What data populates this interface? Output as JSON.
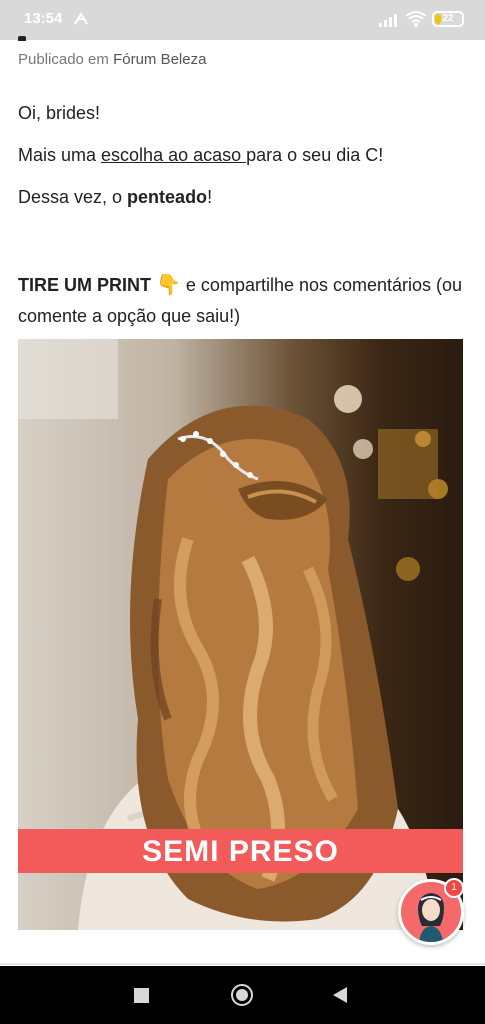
{
  "status_bar": {
    "time": "13:54",
    "battery": "22",
    "battery_level": 0.22,
    "icons": [
      "hd-icon",
      "signal-icon",
      "wifi-icon",
      "battery-icon"
    ]
  },
  "post": {
    "published_prefix": "Publicado em",
    "forum_name": "Fórum Beleza",
    "greeting": "Oi, brides!",
    "line2_before": "Mais uma ",
    "line2_link": "escolha ao acaso ",
    "line2_after": "para o seu dia C!",
    "line3_before": "Dessa vez, o ",
    "line3_bold": "penteado",
    "line3_after": "!",
    "headline_bold": "TIRE UM PRINT",
    "headline_emoji": "👇",
    "headline_rest": " e compartilhe nos comentários (ou comente a opção que saiu!)",
    "image_banner": "SEMI PRESO"
  },
  "chat_avatar": {
    "badge_count": "1",
    "accent_color": "#f46a6a"
  },
  "navigation": {
    "icons": [
      "recent-apps-icon",
      "home-icon",
      "back-icon"
    ]
  },
  "colors": {
    "banner": "#f35a5a",
    "status_bar": "#d9d9d9",
    "nav_bar": "#000000"
  }
}
